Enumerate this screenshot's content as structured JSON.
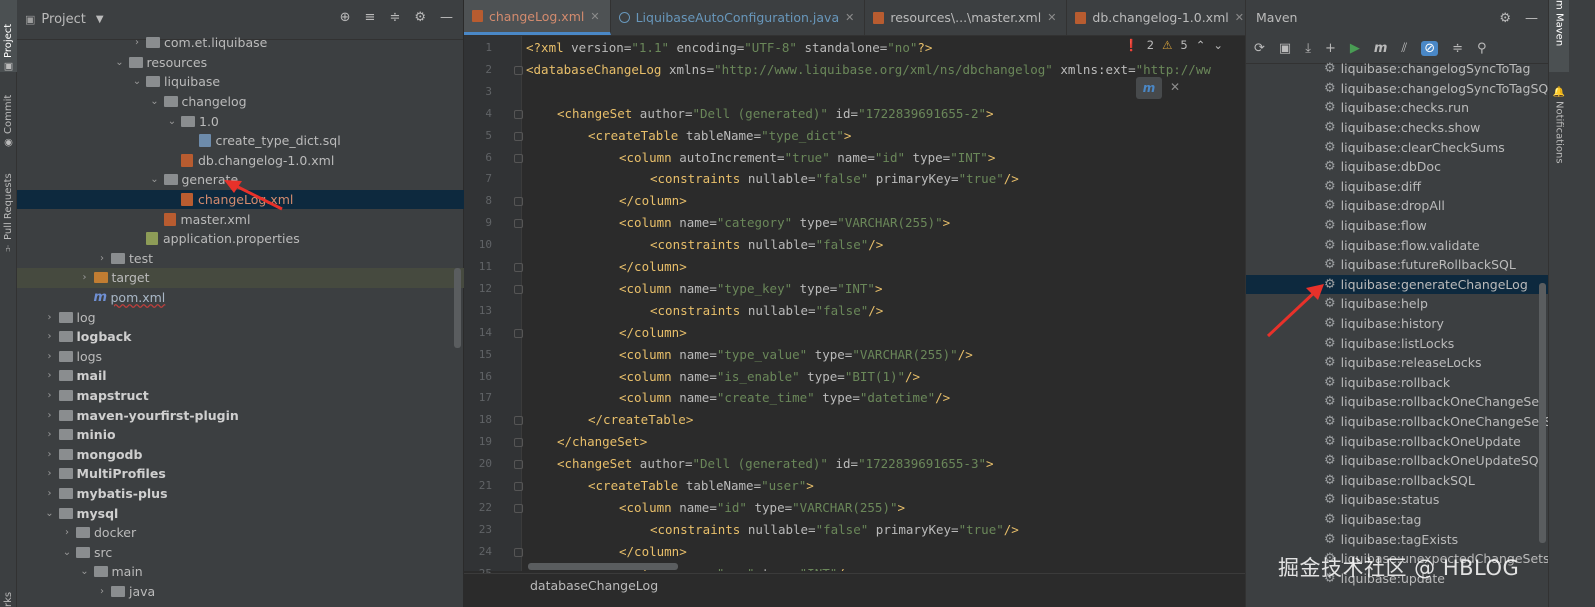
{
  "left_strip": {
    "tabs": [
      {
        "label": "Project",
        "active": true
      },
      {
        "label": "Commit",
        "active": false
      },
      {
        "label": "Pull Requests",
        "active": false
      },
      {
        "label": "rks",
        "active": false
      }
    ]
  },
  "project_panel": {
    "title": "Project",
    "tree": [
      {
        "indent": 6,
        "arrow": "right",
        "icon": "folder",
        "label": "com.et.liquibase",
        "bold": false
      },
      {
        "indent": 5,
        "arrow": "down",
        "icon": "folder-res",
        "label": "resources",
        "bold": false
      },
      {
        "indent": 6,
        "arrow": "down",
        "icon": "folder",
        "label": "liquibase",
        "bold": false
      },
      {
        "indent": 7,
        "arrow": "down",
        "icon": "folder",
        "label": "changelog",
        "bold": false
      },
      {
        "indent": 8,
        "arrow": "down",
        "icon": "folder",
        "label": "1.0",
        "bold": false
      },
      {
        "indent": 9,
        "arrow": "none",
        "icon": "sql",
        "label": "create_type_dict.sql",
        "bold": false
      },
      {
        "indent": 8,
        "arrow": "none",
        "icon": "xml",
        "label": "db.changelog-1.0.xml",
        "bold": false
      },
      {
        "indent": 7,
        "arrow": "down",
        "icon": "folder",
        "label": "generate",
        "bold": false
      },
      {
        "indent": 8,
        "arrow": "none",
        "icon": "xml",
        "label": "changeLog.xml",
        "bold": false,
        "selected": true
      },
      {
        "indent": 7,
        "arrow": "none",
        "icon": "xml",
        "label": "master.xml",
        "bold": false
      },
      {
        "indent": 6,
        "arrow": "none",
        "icon": "prop",
        "label": "application.properties",
        "bold": false
      },
      {
        "indent": 4,
        "arrow": "right",
        "icon": "folder",
        "label": "test",
        "bold": false
      },
      {
        "indent": 3,
        "arrow": "right",
        "icon": "folder-orange",
        "label": "target",
        "bold": false,
        "highlight": true
      },
      {
        "indent": 3,
        "arrow": "none",
        "icon": "maven",
        "label": "pom.xml",
        "bold": false,
        "underline": true
      },
      {
        "indent": 1,
        "arrow": "right",
        "icon": "folder",
        "label": "log",
        "bold": false
      },
      {
        "indent": 1,
        "arrow": "right",
        "icon": "folder",
        "label": "logback",
        "bold": true
      },
      {
        "indent": 1,
        "arrow": "right",
        "icon": "folder",
        "label": "logs",
        "bold": false
      },
      {
        "indent": 1,
        "arrow": "right",
        "icon": "folder",
        "label": "mail",
        "bold": true
      },
      {
        "indent": 1,
        "arrow": "right",
        "icon": "folder",
        "label": "mapstruct",
        "bold": true
      },
      {
        "indent": 1,
        "arrow": "right",
        "icon": "folder",
        "label": "maven-yourfirst-plugin",
        "bold": true
      },
      {
        "indent": 1,
        "arrow": "right",
        "icon": "folder",
        "label": "minio",
        "bold": true
      },
      {
        "indent": 1,
        "arrow": "right",
        "icon": "folder",
        "label": "mongodb",
        "bold": true
      },
      {
        "indent": 1,
        "arrow": "right",
        "icon": "folder",
        "label": "MultiProfiles",
        "bold": true
      },
      {
        "indent": 1,
        "arrow": "right",
        "icon": "folder",
        "label": "mybatis-plus",
        "bold": true
      },
      {
        "indent": 1,
        "arrow": "down",
        "icon": "folder",
        "label": "mysql",
        "bold": true
      },
      {
        "indent": 2,
        "arrow": "right",
        "icon": "folder",
        "label": "docker",
        "bold": false
      },
      {
        "indent": 2,
        "arrow": "down",
        "icon": "folder",
        "label": "src",
        "bold": false
      },
      {
        "indent": 3,
        "arrow": "down",
        "icon": "folder",
        "label": "main",
        "bold": false
      },
      {
        "indent": 4,
        "arrow": "right",
        "icon": "folder",
        "label": "java",
        "bold": false
      }
    ]
  },
  "editor": {
    "tabs": [
      {
        "label": "changeLog.xml",
        "type": "xml",
        "active": true
      },
      {
        "label": "LiquibaseAutoConfiguration.java",
        "type": "java",
        "active": false
      },
      {
        "label": "resources\\...\\master.xml",
        "type": "xml",
        "active": false
      },
      {
        "label": "db.changelog-1.0.xml",
        "type": "xml",
        "active": false
      }
    ],
    "errors": "2",
    "warnings": "5",
    "breadcrumb": "databaseChangeLog",
    "lines": [
      {
        "n": "1",
        "indent": 0,
        "parts": [
          [
            "pi",
            "<?xml "
          ],
          [
            "attr",
            "version="
          ],
          [
            "val",
            "\"1.1\" "
          ],
          [
            "attr",
            "encoding="
          ],
          [
            "val",
            "\"UTF-8\" "
          ],
          [
            "attr",
            "standalone="
          ],
          [
            "val",
            "\"no\""
          ],
          [
            "pi",
            "?>"
          ]
        ]
      },
      {
        "n": "2",
        "indent": 0,
        "parts": [
          [
            "tag",
            "<databaseChangeLog "
          ],
          [
            "attr",
            "xmlns="
          ],
          [
            "val",
            "\"http://www.liquibase.org/xml/ns/dbchangelog\" "
          ],
          [
            "attr",
            "xmlns:ext="
          ],
          [
            "val",
            "\"http://ww"
          ]
        ]
      },
      {
        "n": "3",
        "indent": 0,
        "parts": []
      },
      {
        "n": "4",
        "indent": 1,
        "parts": [
          [
            "tag",
            "<changeSet "
          ],
          [
            "attr",
            "author="
          ],
          [
            "val",
            "\"Dell (generated)\" "
          ],
          [
            "attr",
            "id="
          ],
          [
            "val",
            "\"1722839691655-2\""
          ],
          [
            "tag",
            ">"
          ]
        ]
      },
      {
        "n": "5",
        "indent": 2,
        "parts": [
          [
            "tag",
            "<createTable "
          ],
          [
            "attr",
            "tableName="
          ],
          [
            "val",
            "\"type_dict\""
          ],
          [
            "tag",
            ">"
          ]
        ]
      },
      {
        "n": "6",
        "indent": 3,
        "parts": [
          [
            "tag",
            "<column "
          ],
          [
            "attr",
            "autoIncrement="
          ],
          [
            "val",
            "\"true\" "
          ],
          [
            "attr",
            "name="
          ],
          [
            "val",
            "\"id\" "
          ],
          [
            "attr",
            "type="
          ],
          [
            "val",
            "\"INT\""
          ],
          [
            "tag",
            ">"
          ]
        ]
      },
      {
        "n": "7",
        "indent": 4,
        "parts": [
          [
            "tag",
            "<constraints "
          ],
          [
            "attr",
            "nullable="
          ],
          [
            "val",
            "\"false\" "
          ],
          [
            "attr",
            "primaryKey="
          ],
          [
            "val",
            "\"true\""
          ],
          [
            "tag",
            "/>"
          ]
        ]
      },
      {
        "n": "8",
        "indent": 3,
        "parts": [
          [
            "tag",
            "</column>"
          ]
        ]
      },
      {
        "n": "9",
        "indent": 3,
        "parts": [
          [
            "tag",
            "<column "
          ],
          [
            "attr",
            "name="
          ],
          [
            "val",
            "\"category\" "
          ],
          [
            "attr",
            "type="
          ],
          [
            "val",
            "\"VARCHAR(255)\""
          ],
          [
            "tag",
            ">"
          ]
        ]
      },
      {
        "n": "10",
        "indent": 4,
        "parts": [
          [
            "tag",
            "<constraints "
          ],
          [
            "attr",
            "nullable="
          ],
          [
            "val",
            "\"false\""
          ],
          [
            "tag",
            "/>"
          ]
        ]
      },
      {
        "n": "11",
        "indent": 3,
        "parts": [
          [
            "tag",
            "</column>"
          ]
        ]
      },
      {
        "n": "12",
        "indent": 3,
        "parts": [
          [
            "tag",
            "<column "
          ],
          [
            "attr",
            "name="
          ],
          [
            "val",
            "\"type_key\" "
          ],
          [
            "attr",
            "type="
          ],
          [
            "val",
            "\"INT\""
          ],
          [
            "tag",
            ">"
          ]
        ]
      },
      {
        "n": "13",
        "indent": 4,
        "parts": [
          [
            "tag",
            "<constraints "
          ],
          [
            "attr",
            "nullable="
          ],
          [
            "val",
            "\"false\""
          ],
          [
            "tag",
            "/>"
          ]
        ]
      },
      {
        "n": "14",
        "indent": 3,
        "parts": [
          [
            "tag",
            "</column>"
          ]
        ]
      },
      {
        "n": "15",
        "indent": 3,
        "parts": [
          [
            "tag",
            "<column "
          ],
          [
            "attr",
            "name="
          ],
          [
            "val",
            "\"type_value\" "
          ],
          [
            "attr",
            "type="
          ],
          [
            "val",
            "\"VARCHAR(255)\""
          ],
          [
            "tag",
            "/>"
          ]
        ]
      },
      {
        "n": "16",
        "indent": 3,
        "parts": [
          [
            "tag",
            "<column "
          ],
          [
            "attr",
            "name="
          ],
          [
            "val",
            "\"is_enable\" "
          ],
          [
            "attr",
            "type="
          ],
          [
            "val",
            "\"BIT(1)\""
          ],
          [
            "tag",
            "/>"
          ]
        ]
      },
      {
        "n": "17",
        "indent": 3,
        "parts": [
          [
            "tag",
            "<column "
          ],
          [
            "attr",
            "name="
          ],
          [
            "val",
            "\"create_time\" "
          ],
          [
            "attr",
            "type="
          ],
          [
            "val",
            "\"datetime\""
          ],
          [
            "tag",
            "/>"
          ]
        ]
      },
      {
        "n": "18",
        "indent": 2,
        "parts": [
          [
            "tag",
            "</createTable>"
          ]
        ]
      },
      {
        "n": "19",
        "indent": 1,
        "parts": [
          [
            "tag",
            "</changeSet>"
          ]
        ]
      },
      {
        "n": "20",
        "indent": 1,
        "parts": [
          [
            "tag",
            "<changeSet "
          ],
          [
            "attr",
            "author="
          ],
          [
            "val",
            "\"Dell (generated)\" "
          ],
          [
            "attr",
            "id="
          ],
          [
            "val",
            "\"1722839691655-3\""
          ],
          [
            "tag",
            ">"
          ]
        ]
      },
      {
        "n": "21",
        "indent": 2,
        "parts": [
          [
            "tag",
            "<createTable "
          ],
          [
            "attr",
            "tableName="
          ],
          [
            "val",
            "\"user\""
          ],
          [
            "tag",
            ">"
          ]
        ]
      },
      {
        "n": "22",
        "indent": 3,
        "parts": [
          [
            "tag",
            "<column "
          ],
          [
            "attr",
            "name="
          ],
          [
            "val",
            "\"id\" "
          ],
          [
            "attr",
            "type="
          ],
          [
            "val",
            "\"VARCHAR(255)\""
          ],
          [
            "tag",
            ">"
          ]
        ]
      },
      {
        "n": "23",
        "indent": 4,
        "parts": [
          [
            "tag",
            "<constraints "
          ],
          [
            "attr",
            "nullable="
          ],
          [
            "val",
            "\"false\" "
          ],
          [
            "attr",
            "primaryKey="
          ],
          [
            "val",
            "\"true\""
          ],
          [
            "tag",
            "/>"
          ]
        ]
      },
      {
        "n": "24",
        "indent": 3,
        "parts": [
          [
            "tag",
            "</column>"
          ]
        ]
      },
      {
        "n": "25",
        "indent": 3,
        "parts": [
          [
            "tag",
            "<column "
          ],
          [
            "attr",
            "name="
          ],
          [
            "val",
            "\"age\" "
          ],
          [
            "attr",
            "type="
          ],
          [
            "val",
            "\"INT\""
          ],
          [
            "tag",
            "/>"
          ]
        ]
      }
    ]
  },
  "maven_panel": {
    "title": "Maven",
    "goals": [
      "liquibase:changelogSyncToTag",
      "liquibase:changelogSyncToTagSQL",
      "liquibase:checks.run",
      "liquibase:checks.show",
      "liquibase:clearCheckSums",
      "liquibase:dbDoc",
      "liquibase:diff",
      "liquibase:dropAll",
      "liquibase:flow",
      "liquibase:flow.validate",
      "liquibase:futureRollbackSQL",
      "liquibase:generateChangeLog",
      "liquibase:help",
      "liquibase:history",
      "liquibase:listLocks",
      "liquibase:releaseLocks",
      "liquibase:rollback",
      "liquibase:rollbackOneChangeSet",
      "liquibase:rollbackOneChangeSetSQL",
      "liquibase:rollbackOneUpdate",
      "liquibase:rollbackOneUpdateSQL",
      "liquibase:rollbackSQL",
      "liquibase:status",
      "liquibase:tag",
      "liquibase:tagExists",
      "liquibase:unexpectedChangeSets",
      "liquibase:update"
    ],
    "selected_goal": "liquibase:generateChangeLog"
  },
  "right_strip": {
    "tabs": [
      {
        "label": "Maven",
        "active": true
      },
      {
        "label": "Notifications",
        "active": false
      }
    ]
  },
  "watermark": "掘金技术社区 @ HBLOG",
  "colors": {
    "background": "#2b2b2b",
    "panel": "#3c3f41",
    "selection": "#0d293e",
    "accent": "#4a88c7",
    "annotation_arrow": "#e8312a"
  }
}
